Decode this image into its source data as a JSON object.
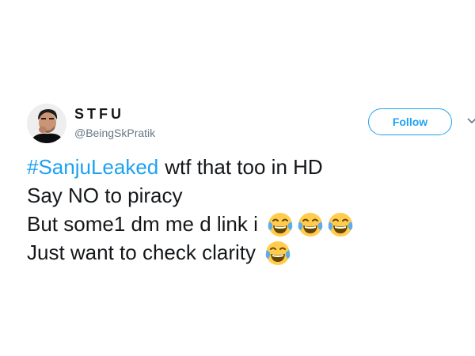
{
  "user": {
    "display_name": "STFU",
    "handle": "@BeingSkPratik",
    "avatar_icon": "profile-photo"
  },
  "actions": {
    "follow_label": "Follow",
    "menu_icon": "chevron-down-icon"
  },
  "tweet": {
    "line1_hashtag": "#SanjuLeaked",
    "line1_text": "wtf that too in HD",
    "line2_text": "Say NO to piracy",
    "line3_text": "But some1 dm me d link i",
    "line3_emoji_count": 3,
    "line4_text": "Just want to check clarity",
    "line4_emoji_count": 1,
    "emoji_icon": "face-with-tears-of-joy-emoji"
  },
  "colors": {
    "link_blue": "#1da1f2",
    "text_dark": "#14171a",
    "handle_gray": "#657786",
    "emoji_yellow": "#ffcc4d",
    "tears_blue": "#5dadec"
  }
}
